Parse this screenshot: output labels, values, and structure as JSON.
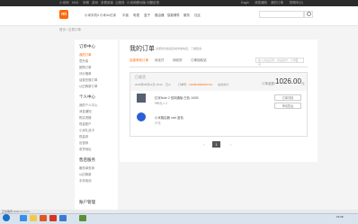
{
  "topbar": {
    "links": [
      "小米网",
      "MIUI",
      "米聊",
      "游戏",
      "多看阅读",
      "云服务",
      "小米网移动版",
      "问题反馈"
    ],
    "right": [
      "Eagle",
      "消息通知",
      "我的订单",
      "购物车(0)"
    ]
  },
  "header": {
    "logo_text": "mi",
    "nav": [
      "小米手机4 小米4c",
      "红米",
      "平板",
      "电视",
      "盒子",
      "路由器",
      "智能硬件",
      "服务",
      "社区"
    ],
    "search_placeholder": ""
  },
  "breadcrumb": "首页 / 交易订单",
  "sidebar": {
    "sections": [
      {
        "title": "订单中心",
        "items": [
          "我的订单",
          "意外保",
          "团购订单",
          "评价晒单",
          "话费充值订单",
          "以旧换新订单"
        ]
      },
      {
        "title": "个人中心",
        "items": [
          "我的个人中心",
          "消息通知",
          "购买资格",
          "现金账户",
          "小米礼品卡",
          "现金券",
          "优惠券",
          "收货地址"
        ]
      },
      {
        "title": "售后服务",
        "items": [
          "服务单查询",
          "以旧换新",
          "手机电池"
        ]
      },
      {
        "title": "账户管理",
        "items": []
      }
    ],
    "active_item": "我的订单"
  },
  "main": {
    "title": "我的订单",
    "subtitle": "请谨防钓鱼链接或诈骗电话，了解更多›",
    "tabs": [
      "全部有效订单",
      "待支付",
      "待收货",
      "订单回收站"
    ],
    "active_tab": "全部有效订单",
    "search_placeholder": "输入商品名称、商品编号、订单号"
  },
  "order": {
    "status": "已收货",
    "date": "2015年08月13日 15:22",
    "recipient": "王xx",
    "order_no_label": "订单号：",
    "order_no": "1150813583307411",
    "payment": "在线支付",
    "total_label": "订单金额：",
    "total_value": "1026.00",
    "total_unit": "元",
    "items": [
      {
        "title": "红米Note 2 双网通版 白色 16GB",
        "price": "999元 × 1"
      },
      {
        "title": "小米路由器 mini 蓝色",
        "price": "27元"
      }
    ],
    "buttons": [
      "订单详情",
      "申请售后"
    ]
  },
  "pager": {
    "prev": "‹",
    "current": "1",
    "next": "›"
  },
  "statusbar": {
    "text": "正在等待 static.mi.com..."
  },
  "taskbar": {
    "clock": "15:38"
  },
  "colors": {
    "accent": "#ff6700",
    "topbar": "#2b2b2b",
    "taskbar": "#d9e3ee"
  }
}
